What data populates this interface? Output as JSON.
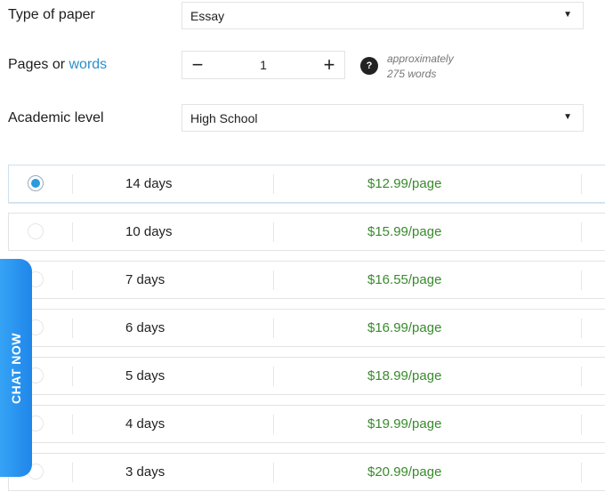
{
  "form": {
    "type_of_paper": {
      "label": "Type of paper",
      "value": "Essay"
    },
    "pages": {
      "label_prefix": "Pages or ",
      "label_link": "words",
      "value": "1",
      "minus": "−",
      "plus": "+",
      "help": "?",
      "approx_line1": "approximately",
      "approx_line2": "275 words"
    },
    "academic_level": {
      "label": "Academic level",
      "value": "High School"
    },
    "caret": "▼"
  },
  "deadlines": [
    {
      "days": "14 days",
      "price": "$12.99/page",
      "selected": true
    },
    {
      "days": "10 days",
      "price": "$15.99/page",
      "selected": false
    },
    {
      "days": "7 days",
      "price": "$16.55/page",
      "selected": false
    },
    {
      "days": "6 days",
      "price": "$16.99/page",
      "selected": false
    },
    {
      "days": "5 days",
      "price": "$18.99/page",
      "selected": false
    },
    {
      "days": "4 days",
      "price": "$19.99/page",
      "selected": false
    },
    {
      "days": "3 days",
      "price": "$20.99/page",
      "selected": false
    }
  ],
  "chat": {
    "label": "CHAT NOW"
  },
  "colors": {
    "accent": "#2a8fc9",
    "price": "#3a8a2e",
    "chat": "#1f86ea"
  }
}
